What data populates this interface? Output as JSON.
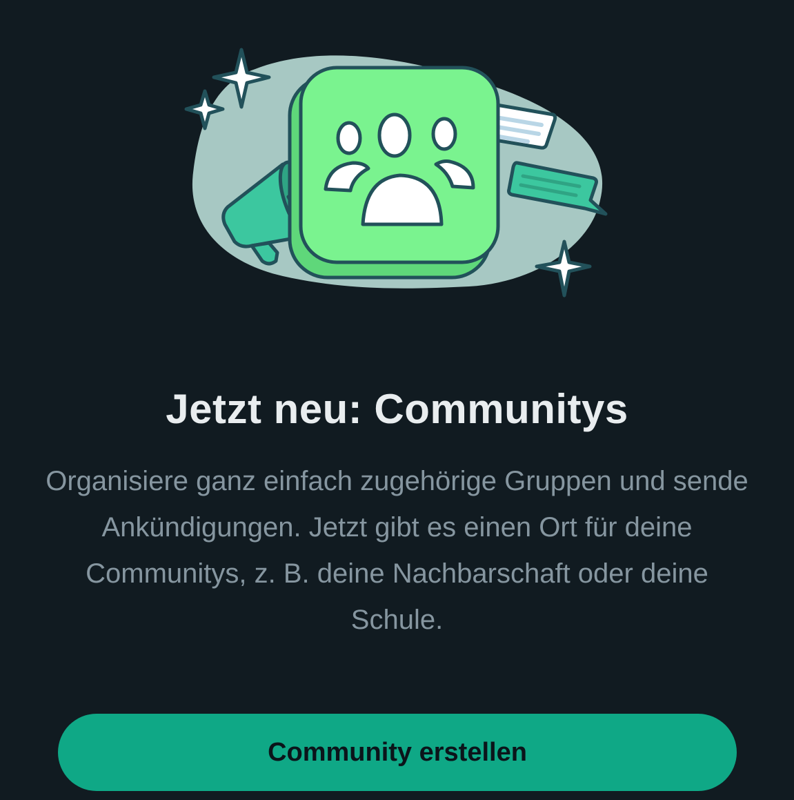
{
  "intro": {
    "title": "Jetzt neu: Communitys",
    "description": "Organisiere ganz einfach zugehörige Gruppen und sende Ankündigungen. Jetzt gibt es einen Ort für deine Communitys, z. B. deine Nachbarschaft oder deine Schule.",
    "cta_label": "Community erstellen"
  },
  "illustration": {
    "icons": [
      "community-group-icon",
      "megaphone-icon",
      "chat-bubble-icon",
      "sparkle-icon"
    ]
  },
  "colors": {
    "background": "#111b21",
    "title": "#e9edef",
    "description": "#8696a0",
    "accent": "#0fa886",
    "illustration_green": "#7af38f",
    "illustration_blob": "#a7c8c3"
  }
}
